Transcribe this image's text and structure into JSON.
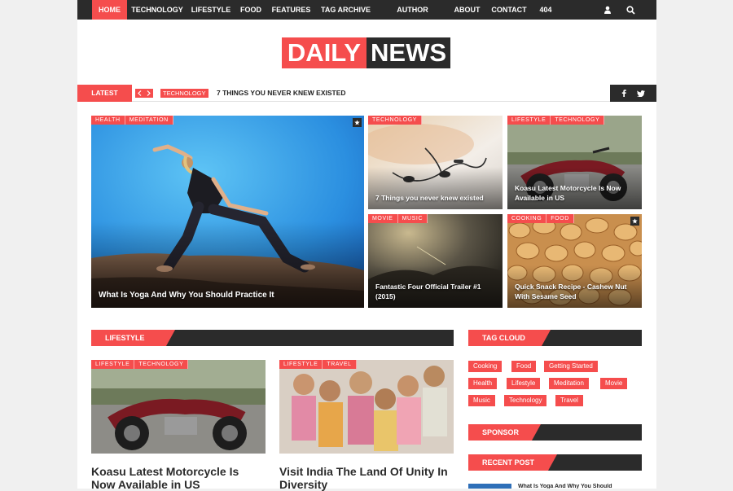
{
  "nav": {
    "items": [
      "HOME",
      "TECHNOLOGY",
      "LIFESTYLE",
      "FOOD",
      "FEATURES",
      "TAG ARCHIVE",
      "AUTHOR ARCHIVE",
      "ABOUT",
      "CONTACT",
      "404"
    ],
    "icons": [
      "user-icon",
      "search-icon"
    ]
  },
  "logo": {
    "part1": "DAILY",
    "part2": "NEWS"
  },
  "ticker": {
    "label": "LATEST",
    "category": "TECHNOLOGY",
    "headline": "7 THINGS YOU NEVER KNEW EXISTED"
  },
  "featured": {
    "main": {
      "tags": [
        "HEALTH",
        "MEDITATION"
      ],
      "title": "What Is Yoga And Why You Should Practice It"
    },
    "c1": {
      "tags": [
        "TECHNOLOGY"
      ],
      "title": "7 Things you never knew existed"
    },
    "c2": {
      "tags": [
        "LIFESTYLE",
        "TECHNOLOGY"
      ],
      "title": "Koasu Latest Motorcycle Is Now Available in US"
    },
    "c3": {
      "tags": [
        "MOVIE",
        "MUSIC"
      ],
      "title": "Fantastic Four Official Trailer #1 (2015)"
    },
    "c4": {
      "tags": [
        "COOKING",
        "FOOD"
      ],
      "title": "Quick Snack Recipe - Cashew Nut With Sesame Seed"
    }
  },
  "lifestyle": {
    "heading": "LIFESTYLE",
    "posts": [
      {
        "tags": [
          "LIFESTYLE",
          "TECHNOLOGY"
        ],
        "title": "Koasu Latest Motorcycle Is Now Available in US"
      },
      {
        "tags": [
          "LIFESTYLE",
          "TRAVEL"
        ],
        "title": "Visit India The Land Of Unity In Diversity"
      }
    ]
  },
  "sidebar": {
    "tagcloud_heading": "TAG CLOUD",
    "tags": [
      "Cooking",
      "Food",
      "Getting Started",
      "Health",
      "Lifestyle",
      "Meditation",
      "Movie",
      "Music",
      "Technology",
      "Travel"
    ],
    "sponsor_heading": "SPONSOR",
    "recent_heading": "RECENT POST",
    "recent_first": "What Is Yoga And Why You Should"
  },
  "colors": {
    "accent": "#f54d4d",
    "dark": "#2b2b2b"
  }
}
